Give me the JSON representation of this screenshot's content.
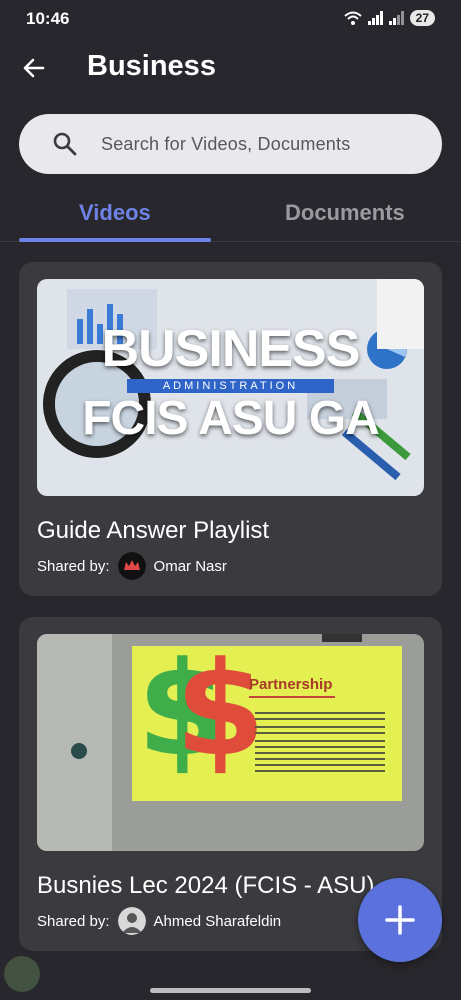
{
  "status": {
    "time": "10:46",
    "battery": "27"
  },
  "header": {
    "title": "Business"
  },
  "search": {
    "placeholder": "Search for Videos, Documents"
  },
  "tabs": [
    {
      "label": "Videos",
      "active": true
    },
    {
      "label": "Documents",
      "active": false
    }
  ],
  "videos": [
    {
      "title": " Guide Answer Playlist",
      "shared_label": "Shared by:",
      "author": "Omar Nasr",
      "thumb_line1": "BUSINESS",
      "thumb_line2": "ADMINISTRATION",
      "thumb_line3": "FCIS ASU GA"
    },
    {
      "title": "Busnies Lec 2024 (FCIS - ASU)",
      "shared_label": "Shared by:",
      "author": "Ahmed Sharafeldin",
      "slide_title": "Partnership"
    }
  ],
  "colors": {
    "accent": "#6f82e6",
    "fab": "#5b72dc",
    "background": "#27272d",
    "card": "#3a3a3f"
  },
  "icons": [
    "back-arrow-icon",
    "search-icon",
    "add-icon",
    "wifi-icon",
    "signal-icon"
  ]
}
